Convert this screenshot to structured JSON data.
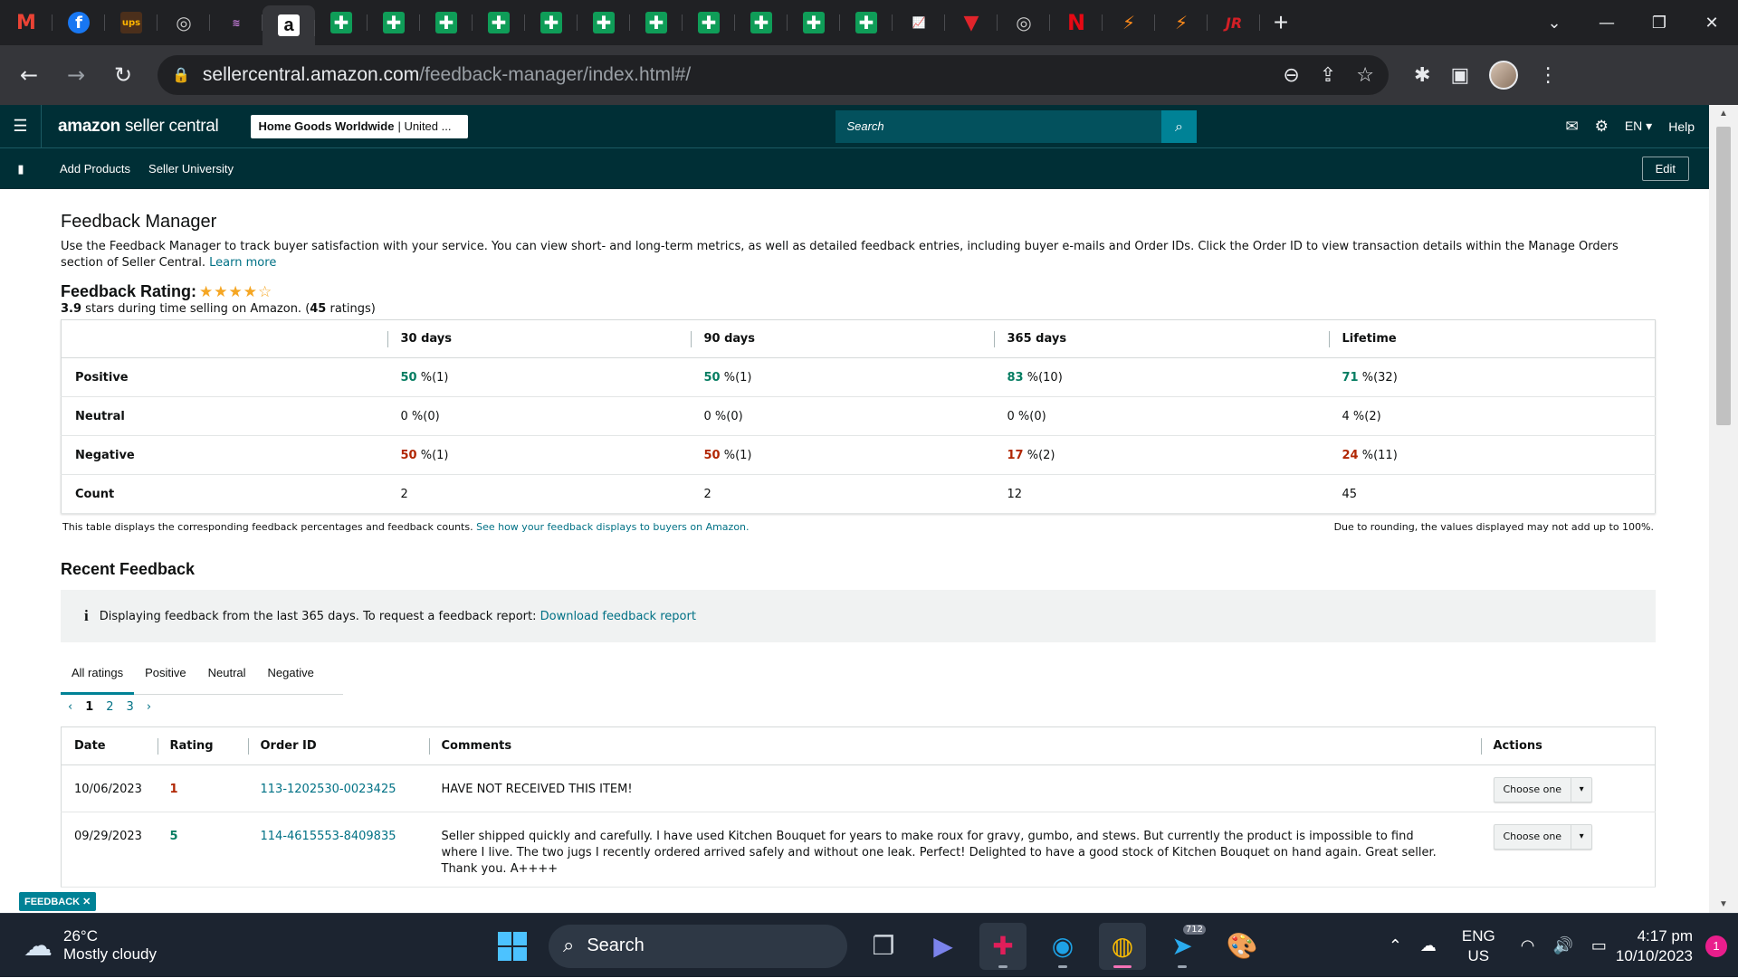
{
  "browser": {
    "tabs": [
      {
        "icon": "gmail-icon",
        "glyph": "M"
      },
      {
        "icon": "facebook-icon",
        "glyph": "f"
      },
      {
        "icon": "ups-icon",
        "glyph": "ups"
      },
      {
        "icon": "globe-icon",
        "glyph": "◎"
      },
      {
        "icon": "walmart-seller-icon",
        "glyph": "≋"
      },
      {
        "icon": "amazon-icon",
        "glyph": "a"
      },
      {
        "icon": "google-sheets-icon",
        "glyph": "✚"
      },
      {
        "icon": "google-sheets-icon",
        "glyph": "✚"
      },
      {
        "icon": "google-sheets-icon",
        "glyph": "✚"
      },
      {
        "icon": "google-sheets-icon",
        "glyph": "✚"
      },
      {
        "icon": "google-sheets-icon",
        "glyph": "✚"
      },
      {
        "icon": "google-sheets-icon",
        "glyph": "✚"
      },
      {
        "icon": "google-sheets-icon",
        "glyph": "✚"
      },
      {
        "icon": "google-sheets-icon",
        "glyph": "✚"
      },
      {
        "icon": "google-sheets-icon",
        "glyph": "✚"
      },
      {
        "icon": "google-sheets-icon",
        "glyph": "✚"
      },
      {
        "icon": "google-sheets-icon",
        "glyph": "✚"
      },
      {
        "icon": "chart-icon",
        "glyph": "📈"
      },
      {
        "icon": "red-logo-icon",
        "glyph": "▼"
      },
      {
        "icon": "globe-icon",
        "glyph": "◎"
      },
      {
        "icon": "netflix-icon",
        "glyph": "N"
      },
      {
        "icon": "stripe-icon",
        "glyph": "⚡"
      },
      {
        "icon": "stripe-icon",
        "glyph": "⚡"
      },
      {
        "icon": "jr-icon",
        "glyph": "JR"
      }
    ],
    "active_tab_index": 5,
    "url_host": "sellercentral.amazon.com",
    "url_path": "/feedback-manager/index.html#/"
  },
  "header": {
    "logo_brand": "amazon",
    "logo_suffix": "seller central",
    "store_name": "Home Goods Worldwide",
    "store_region": "| United ...",
    "search_placeholder": "Search",
    "language": "EN",
    "help": "Help"
  },
  "subnav": {
    "items": [
      "Add Products",
      "Seller University"
    ],
    "edit": "Edit"
  },
  "page": {
    "title": "Feedback Manager",
    "intro": "Use the Feedback Manager to track buyer satisfaction with your service. You can view short- and long-term metrics, as well as detailed feedback entries, including buyer e-mails and Order IDs. Click the Order ID to view transaction details within the Manage Orders section of Seller Central.",
    "learn_more": "Learn more",
    "rating_heading": "Feedback Rating:",
    "stars_filled": 4,
    "stars_total": 5,
    "rating_value": "3.9",
    "rating_text_mid": "stars during time selling on Amazon. (",
    "rating_count": "45",
    "rating_text_end": "ratings)"
  },
  "metrics": {
    "columns": [
      "30 days",
      "90 days",
      "365 days",
      "Lifetime"
    ],
    "rows": [
      {
        "label": "Positive",
        "kind": "pos",
        "cells": [
          [
            "50",
            " %(1)"
          ],
          [
            "50",
            " %(1)"
          ],
          [
            "83",
            " %(10)"
          ],
          [
            "71",
            " %(32)"
          ]
        ]
      },
      {
        "label": "Neutral",
        "kind": "neu",
        "cells": [
          [
            "0",
            " %(0)"
          ],
          [
            "0",
            " %(0)"
          ],
          [
            "0",
            " %(0)"
          ],
          [
            "4",
            " %(2)"
          ]
        ]
      },
      {
        "label": "Negative",
        "kind": "neg",
        "cells": [
          [
            "50",
            " %(1)"
          ],
          [
            "50",
            " %(1)"
          ],
          [
            "17",
            " %(2)"
          ],
          [
            "24",
            " %(11)"
          ]
        ]
      },
      {
        "label": "Count",
        "kind": "count",
        "cells": [
          [
            "2",
            ""
          ],
          [
            "2",
            ""
          ],
          [
            "12",
            ""
          ],
          [
            "45",
            ""
          ]
        ]
      }
    ],
    "note_left": "This table displays the corresponding feedback percentages and feedback counts.",
    "note_link": "See how your feedback displays to buyers on Amazon.",
    "note_right": "Due to rounding, the values displayed may not add up to 100%."
  },
  "recent": {
    "heading": "Recent Feedback",
    "info_text": "Displaying feedback from the last 365 days. To request a feedback report:",
    "info_link": "Download feedback report",
    "tabs": [
      "All ratings",
      "Positive",
      "Neutral",
      "Negative"
    ],
    "active_tab": 0,
    "pages": [
      "1",
      "2",
      "3"
    ],
    "current_page": "1",
    "columns": [
      "Date",
      "Rating",
      "Order ID",
      "Comments",
      "Actions"
    ],
    "rows": [
      {
        "date": "10/06/2023",
        "rating": "1",
        "order_id": "113-1202530-0023425",
        "comment": "HAVE NOT RECEIVED THIS ITEM!",
        "action": "Choose one"
      },
      {
        "date": "09/29/2023",
        "rating": "5",
        "order_id": "114-4615553-8409835",
        "comment": "Seller shipped quickly and carefully. I have used Kitchen Bouquet for years to make roux for gravy, gumbo, and stews. But currently the product is impossible to find where I live. The two jugs I recently ordered arrived safely and without one leak. Perfect! Delighted to have a good stock of Kitchen Bouquet on hand again. Great seller. Thank you. A++++",
        "action": "Choose one"
      }
    ]
  },
  "feedback_tag": "FEEDBACK ✕",
  "taskbar": {
    "temp": "26°C",
    "condition": "Mostly cloudy",
    "search": "Search",
    "telegram_badge": "712",
    "lang1": "ENG",
    "lang2": "US",
    "time": "4:17 pm",
    "date": "10/10/2023",
    "notifications": "1"
  },
  "colors": {
    "header_bg": "#002f36",
    "link": "#007185",
    "positive": "#067d62",
    "negative": "#b12704",
    "star": "#f5a623"
  }
}
